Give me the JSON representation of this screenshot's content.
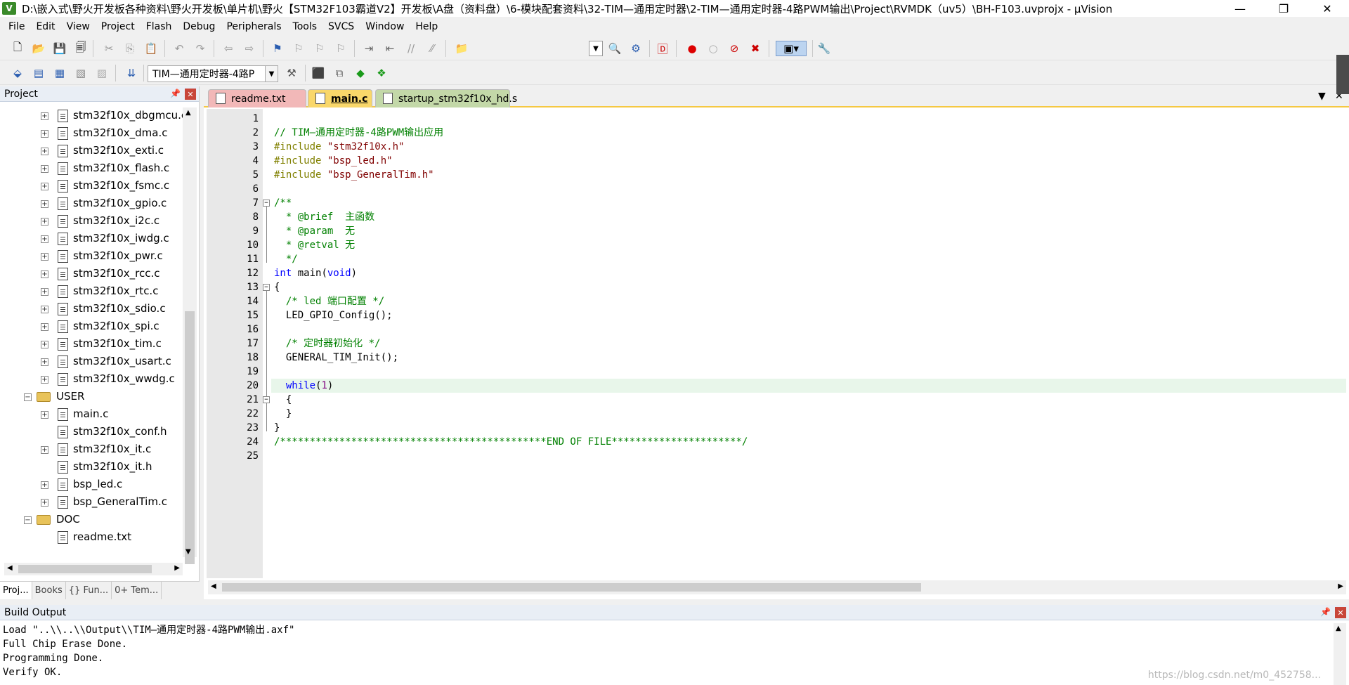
{
  "window": {
    "title": "D:\\嵌入式\\野火开发板各种资料\\野火开发板\\单片机\\野火【STM32F103霸道V2】开发板\\A盘（资料盘）\\6-模块配套资料\\32-TIM—通用定时器\\2-TIM—通用定时器-4路PWM输出\\Project\\RVMDK（uv5）\\BH-F103.uvprojx - µVision",
    "app_icon": "V",
    "controls": {
      "minimize": "—",
      "maximize": "❐",
      "close": "✕"
    }
  },
  "menu": [
    "File",
    "Edit",
    "View",
    "Project",
    "Flash",
    "Debug",
    "Peripherals",
    "Tools",
    "SVCS",
    "Window",
    "Help"
  ],
  "toolbar2": {
    "target": "TIM—通用定时器-4路P"
  },
  "project_panel": {
    "title": "Project",
    "tree": [
      {
        "label": "stm32f10x_dbgmcu.c",
        "kind": "file",
        "plus": true
      },
      {
        "label": "stm32f10x_dma.c",
        "kind": "file",
        "plus": true
      },
      {
        "label": "stm32f10x_exti.c",
        "kind": "file",
        "plus": true
      },
      {
        "label": "stm32f10x_flash.c",
        "kind": "file",
        "plus": true
      },
      {
        "label": "stm32f10x_fsmc.c",
        "kind": "file",
        "plus": true
      },
      {
        "label": "stm32f10x_gpio.c",
        "kind": "file",
        "plus": true
      },
      {
        "label": "stm32f10x_i2c.c",
        "kind": "file",
        "plus": true
      },
      {
        "label": "stm32f10x_iwdg.c",
        "kind": "file",
        "plus": true
      },
      {
        "label": "stm32f10x_pwr.c",
        "kind": "file",
        "plus": true
      },
      {
        "label": "stm32f10x_rcc.c",
        "kind": "file",
        "plus": true
      },
      {
        "label": "stm32f10x_rtc.c",
        "kind": "file",
        "plus": true
      },
      {
        "label": "stm32f10x_sdio.c",
        "kind": "file",
        "plus": true
      },
      {
        "label": "stm32f10x_spi.c",
        "kind": "file",
        "plus": true
      },
      {
        "label": "stm32f10x_tim.c",
        "kind": "file",
        "plus": true
      },
      {
        "label": "stm32f10x_usart.c",
        "kind": "file",
        "plus": true
      },
      {
        "label": "stm32f10x_wwdg.c",
        "kind": "file",
        "plus": true
      },
      {
        "label": "USER",
        "kind": "folder",
        "plus": false
      },
      {
        "label": "main.c",
        "kind": "file",
        "plus": true
      },
      {
        "label": "stm32f10x_conf.h",
        "kind": "file",
        "plus": false
      },
      {
        "label": "stm32f10x_it.c",
        "kind": "file",
        "plus": true
      },
      {
        "label": "stm32f10x_it.h",
        "kind": "file",
        "plus": false
      },
      {
        "label": "bsp_led.c",
        "kind": "file",
        "plus": true
      },
      {
        "label": "bsp_GeneralTim.c",
        "kind": "file",
        "plus": true
      },
      {
        "label": "DOC",
        "kind": "folder",
        "plus": false
      },
      {
        "label": "readme.txt",
        "kind": "file",
        "plus": false
      }
    ],
    "tabs": [
      "Proj...",
      "Books",
      "{} Fun...",
      "0+ Tem..."
    ]
  },
  "editor": {
    "tabs": [
      "readme.txt",
      "main.c",
      "startup_stm32f10x_hd.s"
    ],
    "active_tab": "main.c",
    "current_line": 20,
    "lines": [
      "",
      "// TIM—通用定时器-4路PWM输出应用",
      "#include \"stm32f10x.h\"",
      "#include \"bsp_led.h\"",
      "#include \"bsp_GeneralTim.h\"",
      "",
      "/**",
      "  * @brief  主函数",
      "  * @param  无",
      "  * @retval 无",
      "  */",
      "int main(void)",
      "{",
      "  /* led 端口配置 */",
      "  LED_GPIO_Config();",
      "",
      "  /* 定时器初始化 */",
      "  GENERAL_TIM_Init();",
      "",
      "  while(1)",
      "  {",
      "  }",
      "}",
      "/*********************************************END OF FILE**********************/",
      ""
    ]
  },
  "build_output": {
    "title": "Build Output",
    "lines": [
      "Load \"..\\\\..\\\\Output\\\\TIM—通用定时器-4路PWM输出.axf\"",
      "Full Chip Erase Done.",
      "Programming Done.",
      "Verify OK."
    ],
    "watermark": "https://blog.csdn.net/m0_452758..."
  }
}
